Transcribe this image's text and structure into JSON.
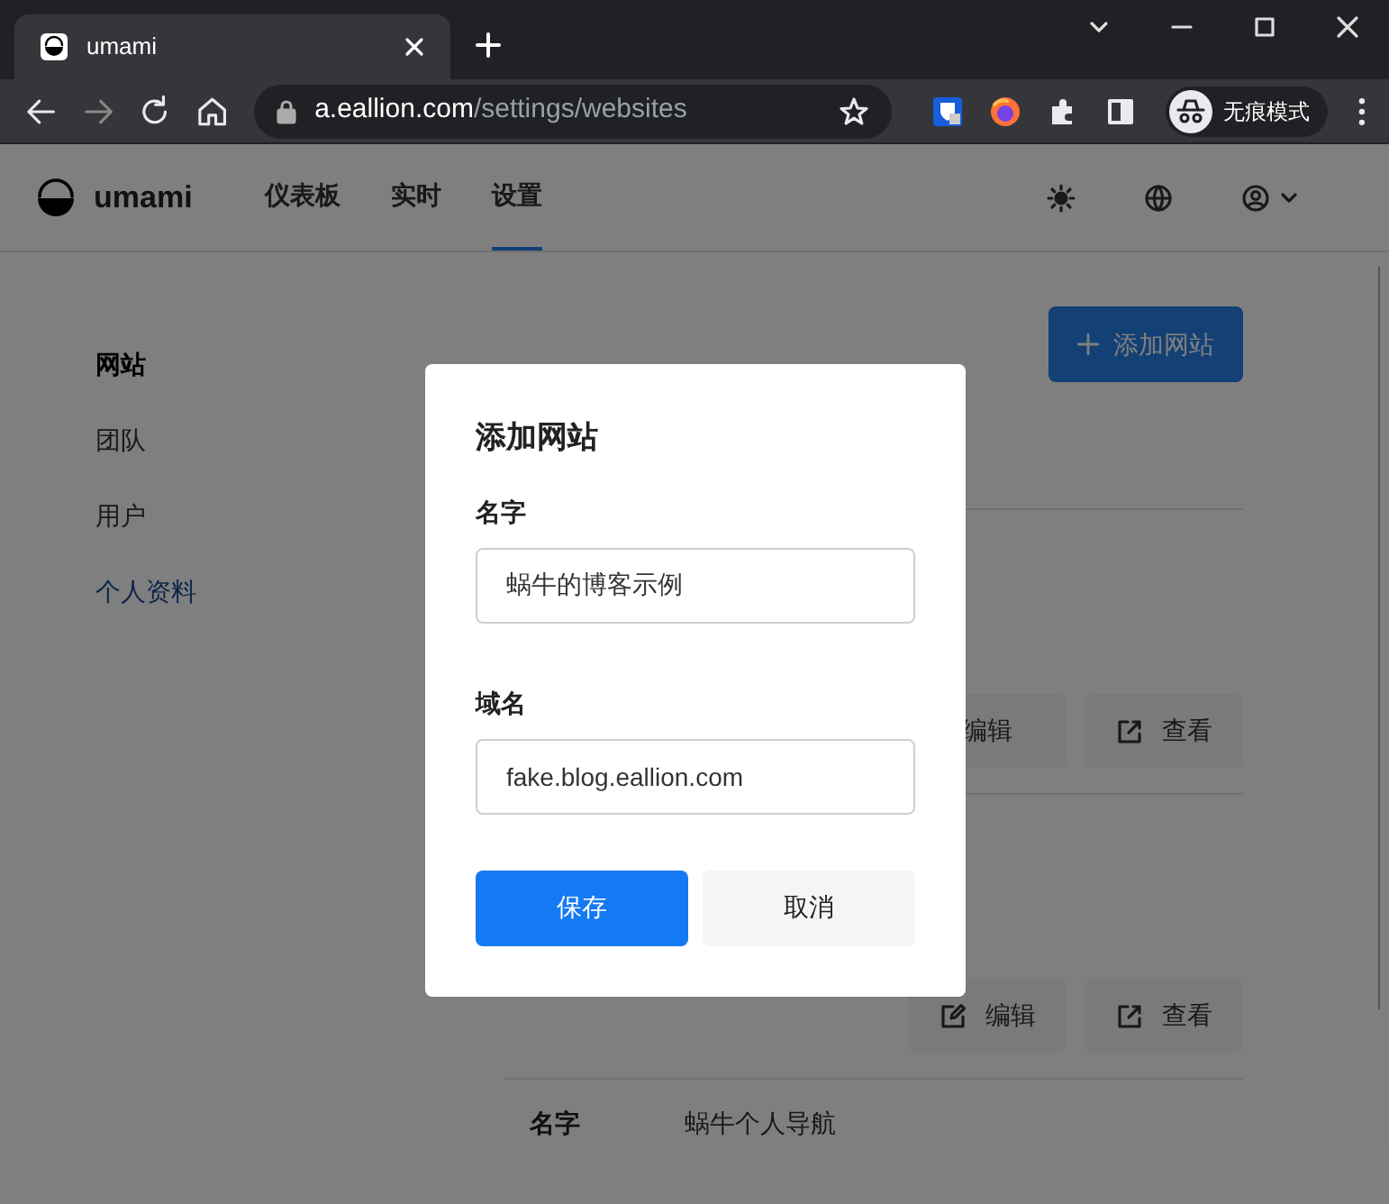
{
  "browser": {
    "tab": {
      "title": "umami"
    },
    "address": {
      "host": "a.eallion.com",
      "path": "/settings/websites"
    },
    "profile": {
      "label": "无痕模式"
    },
    "back_disabled": false,
    "forward_disabled": true
  },
  "app": {
    "brand": "umami",
    "nav": [
      {
        "label": "仪表板",
        "selected": false
      },
      {
        "label": "实时",
        "selected": false
      },
      {
        "label": "设置",
        "selected": true
      }
    ],
    "sidebar": [
      {
        "label": "网站",
        "selected": true
      },
      {
        "label": "团队",
        "selected": false
      },
      {
        "label": "用户",
        "selected": false
      },
      {
        "label": "个人资料",
        "selected": false
      }
    ],
    "add_button": {
      "label": "添加网站"
    },
    "rows": [
      {
        "buttons": [
          {
            "kind": "edit",
            "label": "编辑"
          },
          {
            "kind": "view",
            "label": "查看"
          }
        ]
      },
      {
        "buttons": [
          {
            "kind": "edit",
            "label": "编辑"
          },
          {
            "kind": "view",
            "label": "查看"
          }
        ]
      }
    ],
    "partial_row": {
      "fields": [
        {
          "label": "名字",
          "value": "蜗牛个人导航"
        }
      ]
    }
  },
  "dialog": {
    "title": "添加网站",
    "fields": [
      {
        "label": "名字",
        "value": "蜗牛的博客示例"
      },
      {
        "label": "域名",
        "value": "fake.blog.eallion.com"
      }
    ],
    "buttons": [
      {
        "kind": "primary",
        "label": "保存"
      },
      {
        "kind": "secondary",
        "label": "取消"
      }
    ]
  }
}
